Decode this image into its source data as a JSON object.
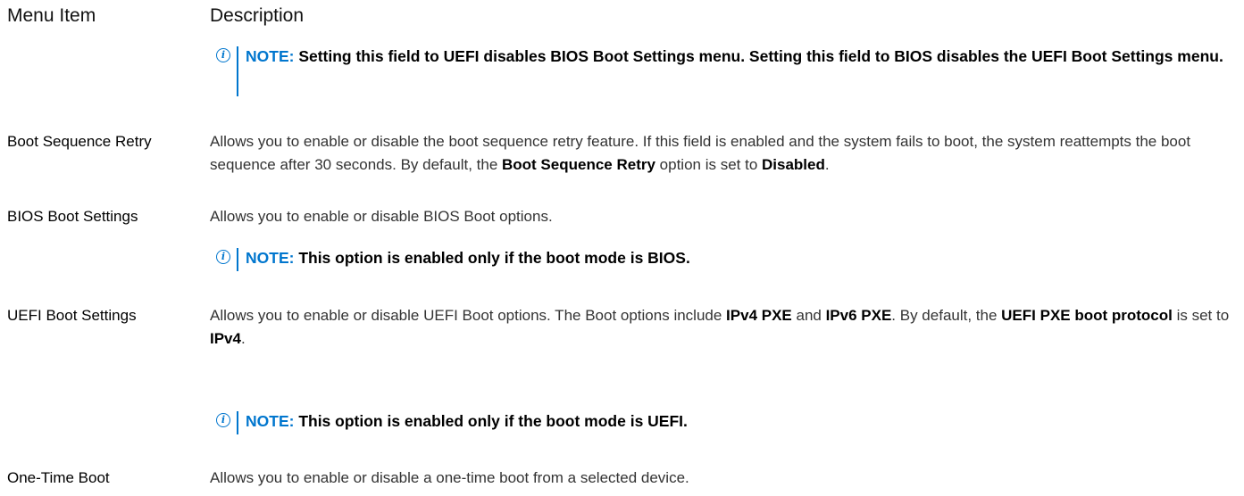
{
  "header": {
    "menu_item": "Menu Item",
    "description": "Description"
  },
  "note_label": "NOTE:",
  "note_top": {
    "text": " Setting this field to UEFI disables BIOS Boot Settings menu. Setting this field to BIOS disables the UEFI Boot Settings menu."
  },
  "boot_sequence_retry": {
    "label": "Boot Sequence Retry",
    "d1": "Allows you to enable or disable the boot sequence retry feature. If this field is enabled and the system fails to boot, the system reattempts the boot sequence after 30 seconds. By default, the ",
    "b1": "Boot Sequence Retry",
    "d2": " option is set to ",
    "b2": "Disabled",
    "d3": "."
  },
  "bios_boot_settings": {
    "label": "BIOS Boot Settings",
    "desc": "Allows you to enable or disable BIOS Boot options.",
    "note": " This option is enabled only if the boot mode is BIOS."
  },
  "uefi_boot_settings": {
    "label": "UEFI Boot Settings",
    "d1": "Allows you to enable or disable UEFI Boot options. The Boot options include ",
    "b1": "IPv4 PXE",
    "d2": " and ",
    "b2": "IPv6 PXE",
    "d3": ". By default, the ",
    "b3": "UEFI PXE boot protocol",
    "d4": " is set to ",
    "b4": "IPv4",
    "d5": ".",
    "note": " This option is enabled only if the boot mode is UEFI."
  },
  "one_time_boot": {
    "label": "One-Time Boot",
    "desc": "Allows you to enable or disable a one-time boot from a selected device."
  }
}
